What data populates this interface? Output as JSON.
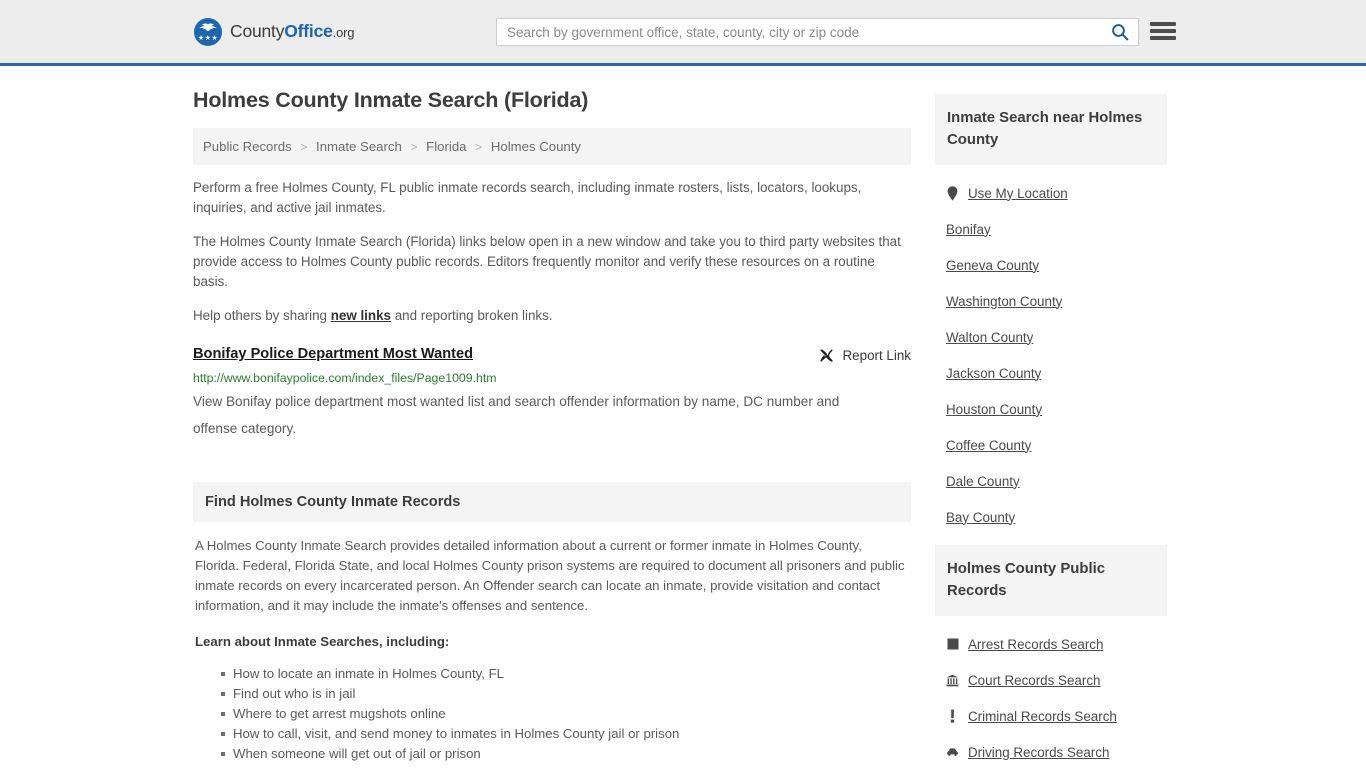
{
  "header": {
    "logo": {
      "part1": "County",
      "part2": "Office",
      "part3": ".org",
      "icon": "eagle-shield-icon",
      "stars": "★★★"
    },
    "search": {
      "placeholder": "Search by government office, state, county, city or zip code",
      "value": "",
      "search_icon": "search-icon"
    },
    "menu_icon": "hamburger-menu-icon",
    "accent_color": "#1d66ad",
    "border_color": "#2c6aa5"
  },
  "main": {
    "title": "Holmes County Inmate Search (Florida)",
    "breadcrumb": [
      "Public Records",
      "Inmate Search",
      "Florida",
      "Holmes County"
    ],
    "breadcrumb_separator": ">",
    "intro": [
      "Perform a free Holmes County, FL public inmate records search, including inmate rosters, lists, locators, lookups, inquiries, and active jail inmates.",
      "The Holmes County Inmate Search (Florida) links below open in a new window and take you to third party websites that provide access to Holmes County public records. Editors frequently monitor and verify these resources on a routine basis."
    ],
    "share_prefix": "Help others by sharing ",
    "share_link": "new links",
    "share_suffix": " and reporting broken links.",
    "result": {
      "title": "Bonifay Police Department Most Wanted",
      "url": "http://www.bonifaypolice.com/index_files/Page1009.htm",
      "description": "View Bonifay police department most wanted list and search offender information by name, DC number and offense category.",
      "report_label": "Report Link",
      "report_icon": "broken-link-icon",
      "url_color": "#2e7d32"
    },
    "section": {
      "heading": "Find Holmes County Inmate Records",
      "paragraph": "A Holmes County Inmate Search provides detailed information about a current or former inmate in Holmes County, Florida. Federal, Florida State, and local Holmes County prison systems are required to document all prisoners and public inmate records on every incarcerated person. An Offender search can locate an inmate, provide visitation and contact information, and it may include the inmate's offenses and sentence.",
      "list_heading": "Learn about Inmate Searches, including:",
      "bullets": [
        "How to locate an inmate in Holmes County, FL",
        "Find out who is in jail",
        "Where to get arrest mugshots online",
        "How to call, visit, and send money to inmates in Holmes County jail or prison",
        "When someone will get out of jail or prison"
      ]
    }
  },
  "sidebar": {
    "nearby": {
      "heading": "Inmate Search near Holmes County",
      "items": [
        {
          "label": "Use My Location",
          "icon": "map-pin-icon"
        },
        {
          "label": "Bonifay",
          "icon": ""
        },
        {
          "label": "Geneva County",
          "icon": ""
        },
        {
          "label": "Washington County",
          "icon": ""
        },
        {
          "label": "Walton County",
          "icon": ""
        },
        {
          "label": "Jackson County",
          "icon": ""
        },
        {
          "label": "Houston County",
          "icon": ""
        },
        {
          "label": "Coffee County",
          "icon": ""
        },
        {
          "label": "Dale County",
          "icon": ""
        },
        {
          "label": "Bay County",
          "icon": ""
        }
      ]
    },
    "public_records": {
      "heading": "Holmes County Public Records",
      "items": [
        {
          "label": "Arrest Records Search",
          "icon": "fingerprint-icon"
        },
        {
          "label": "Court Records Search",
          "icon": "courthouse-icon"
        },
        {
          "label": "Criminal Records Search",
          "icon": "exclamation-icon"
        },
        {
          "label": "Driving Records Search",
          "icon": "car-icon"
        }
      ]
    }
  }
}
